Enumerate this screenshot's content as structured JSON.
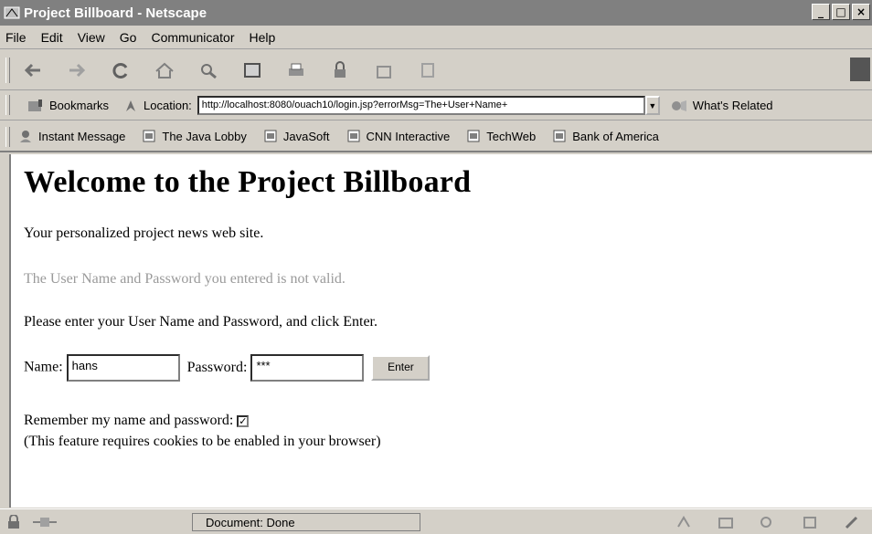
{
  "window": {
    "title": "Project Billboard - Netscape"
  },
  "menu": [
    "File",
    "Edit",
    "View",
    "Go",
    "Communicator",
    "Help"
  ],
  "toolbar_icons": [
    "back-icon",
    "forward-icon",
    "reload-icon",
    "home-icon",
    "search-icon",
    "guide-icon",
    "print-icon",
    "security-icon",
    "stop-icon",
    "shop-icon"
  ],
  "location": {
    "bookmarks_label": "Bookmarks",
    "location_label": "Location:",
    "url": "http://localhost:8080/ouach10/login.jsp?errorMsg=The+User+Name+",
    "related_label": "What's Related"
  },
  "personal_toolbar": [
    "Instant Message",
    "The Java Lobby",
    "JavaSoft",
    "CNN Interactive",
    "TechWeb",
    "Bank of America"
  ],
  "page": {
    "heading": "Welcome to the Project Billboard",
    "tagline": "Your personalized project news web site.",
    "error": "The User Name and Password you entered is not valid.",
    "instruction": "Please enter your User Name and Password, and click Enter.",
    "name_label": "Name:",
    "name_value": "hans",
    "password_label": "Password:",
    "password_value": "***",
    "enter_label": "Enter",
    "remember_label": "Remember my name and password:",
    "remember_checked": "✓",
    "cookie_note": "(This feature requires cookies to be enabled in your browser)"
  },
  "status": {
    "text": "Document: Done"
  }
}
